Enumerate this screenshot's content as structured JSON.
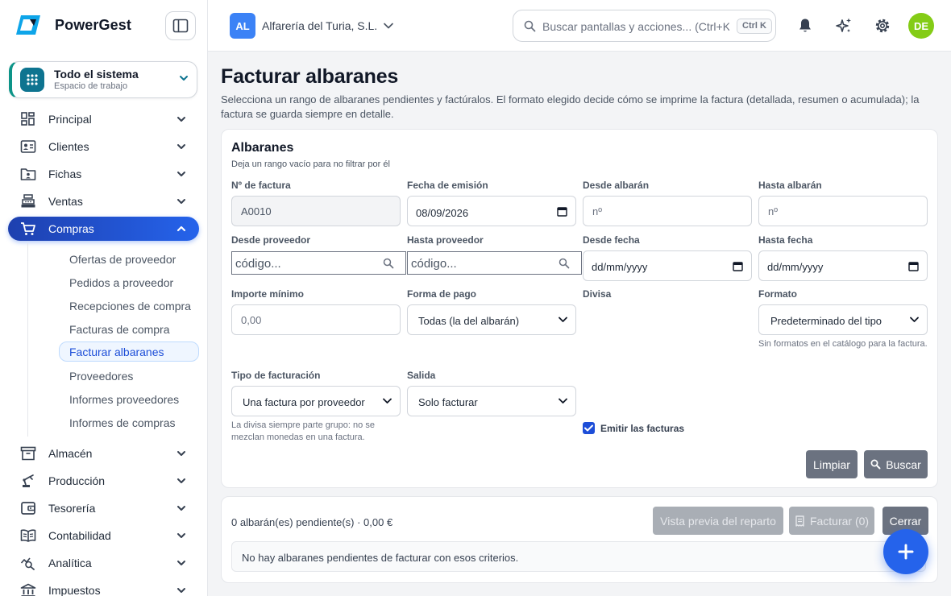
{
  "app": {
    "name": "PowerGest"
  },
  "workspace": {
    "title": "Todo el sistema",
    "subtitle": "Espacio de trabajo"
  },
  "nav": {
    "items": [
      {
        "label": "Principal",
        "icon": "dashboard-icon"
      },
      {
        "label": "Clientes",
        "icon": "contact-card-icon"
      },
      {
        "label": "Fichas",
        "icon": "folder-user-icon"
      },
      {
        "label": "Ventas",
        "icon": "cash-register-icon"
      },
      {
        "label": "Compras",
        "icon": "shopping-cart-icon",
        "active": true
      },
      {
        "label": "Almacén",
        "icon": "archive-box-icon"
      },
      {
        "label": "Producción",
        "icon": "robot-arm-icon"
      },
      {
        "label": "Tesorería",
        "icon": "wallet-icon"
      },
      {
        "label": "Contabilidad",
        "icon": "book-open-icon"
      },
      {
        "label": "Analítica",
        "icon": "chart-search-icon"
      },
      {
        "label": "Impuestos",
        "icon": "bank-icon"
      }
    ],
    "compras_sub": [
      "Ofertas de proveedor",
      "Pedidos a proveedor",
      "Recepciones de compra",
      "Facturas de compra",
      "Facturar albaranes",
      "Proveedores",
      "Informes proveedores",
      "Informes de compras"
    ],
    "active_sub": "Facturar albaranes"
  },
  "topbar": {
    "company_initials": "AL",
    "company_name": "Alfarería del Turia, S.L.",
    "search_placeholder": "Buscar pantallas y acciones... (Ctrl+K)",
    "search_shortcut": "Ctrl K",
    "user_initials": "DE"
  },
  "page": {
    "title": "Facturar albaranes",
    "description": "Selecciona un rango de albaranes pendientes y factúralos. El formato elegido decide cómo se imprime la factura (detallada, resumen o acumulada); la factura se guarda siempre en detalle."
  },
  "form": {
    "title": "Albaranes",
    "subtitle": "Deja un rango vacío para no filtrar por él",
    "invoice_no": {
      "label": "Nº de factura",
      "value": "A0010"
    },
    "issue_date": {
      "label": "Fecha de emisión",
      "value": "08/09/2026"
    },
    "from_delivery": {
      "label": "Desde albarán",
      "placeholder": "nº"
    },
    "to_delivery": {
      "label": "Hasta albarán",
      "placeholder": "nº"
    },
    "from_supplier": {
      "label": "Desde proveedor",
      "placeholder": "código..."
    },
    "to_supplier": {
      "label": "Hasta proveedor",
      "placeholder": "código..."
    },
    "from_date": {
      "label": "Desde fecha",
      "value": "dd/mm/yyyy"
    },
    "to_date": {
      "label": "Hasta fecha",
      "value": "dd/mm/yyyy"
    },
    "min_amount": {
      "label": "Importe mínimo",
      "placeholder": "0,00"
    },
    "payment_method": {
      "label": "Forma de pago",
      "value": "Todas (la del albarán)"
    },
    "currency": {
      "label": "Divisa"
    },
    "format": {
      "label": "Formato",
      "value": "Predeterminado del tipo",
      "help": "Sin formatos en el catálogo para la factura."
    },
    "billing_type": {
      "label": "Tipo de facturación",
      "value": "Una factura por proveedor",
      "help": "La divisa siempre parte grupo: no se mezclan monedas en una factura."
    },
    "output": {
      "label": "Salida",
      "value": "Solo facturar"
    },
    "emit_invoices": {
      "label": "Emitir las facturas",
      "checked": true
    },
    "clear_label": "Limpiar",
    "search_label": "Buscar"
  },
  "results": {
    "summary": "0 albarán(es) pendiente(s) · 0,00 €",
    "preview_label": "Vista previa del reparto",
    "invoice_label": "Facturar (0)",
    "close_label": "Cerrar",
    "empty_message": "No hay albaranes pendientes de facturar con esos criterios."
  },
  "colors": {
    "accent": "#2563eb",
    "workspace_accent": "#0d9488",
    "user_avatar": "#84cc16"
  }
}
